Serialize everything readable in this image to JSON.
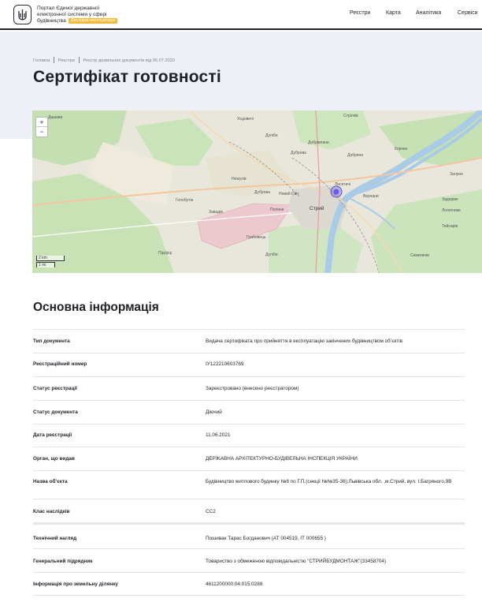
{
  "header": {
    "portal_line1": "Портал Єдиної державної",
    "portal_line2": "електронної системи у сфері",
    "portal_line3": "будівництва",
    "badge": "Дослідна експлуатація",
    "nav": [
      "Реєстри",
      "Карта",
      "Аналітика",
      "Сервіси"
    ]
  },
  "breadcrumbs": [
    "Головна",
    "Реєстри",
    "Реєстр дозвільних документів від 06.07.2020"
  ],
  "page_title": "Сертифікат готовності",
  "map": {
    "zoom_in": "+",
    "zoom_out": "−",
    "scale_km": "2 km",
    "scale_mi": "1 mi",
    "places": [
      "Дашава",
      "Ходовичі",
      "Стрілків",
      "Дуліби",
      "Дуброва",
      "Добрівляни",
      "Добряни",
      "Лисятичі",
      "Нежухів",
      "Дуброва",
      "Голобутів",
      "Новий Світ",
      "Завадів",
      "Поляни",
      "Стрий",
      "Грабовець",
      "Верчани",
      "Корчин",
      "Загірне",
      "Тейсарів",
      "Задеріве",
      "Лотатники",
      "Дуліби",
      "Підгірці",
      "Семигинів"
    ]
  },
  "section_title": "Основна інформація",
  "info": [
    {
      "label": "Тип документа",
      "value": "Видача сертифіката про прийняття в експлуатацію закінчених будівництвом об’єктів"
    },
    {
      "label": "Реєстраційний номер",
      "value": "IУ122210603769"
    },
    {
      "label": "Статус реєстрації",
      "value": "Зареєстровано (внесено реєстратором)"
    },
    {
      "label": "Статус документа",
      "value": "Діючий"
    },
    {
      "label": "Дата реєстрації",
      "value": "11.06.2021"
    },
    {
      "label": "Орган, що видав",
      "value": "ДЕРЖАВНА АРХІТЕКТУРНО-БУДІВЕЛЬНА ІНСПЕКЦІЯ УКРАЇНИ"
    },
    {
      "label": "Назва об’єкта",
      "value": "Будівництво житлового будинку №6 по Г.П.(секції №№35-36);Львівська обл. ,м.Стрий, вул. І.Багряного,9В"
    },
    {
      "label": "Клас наслідків",
      "value": "СС2"
    },
    {
      "label": "Технічний нагляд",
      "value": "Пошивак Тарас Богданович (АТ 004519, ІТ 000655 )"
    },
    {
      "label": "Генеральний підрядник",
      "value": "Товариство з обмеженою відповідальністю \"СТРИЙБУДМОНТАЖ\"(33458704)"
    },
    {
      "label": "Інформація про земельну ділянку",
      "value": "4611200000:04:015:0288"
    }
  ]
}
